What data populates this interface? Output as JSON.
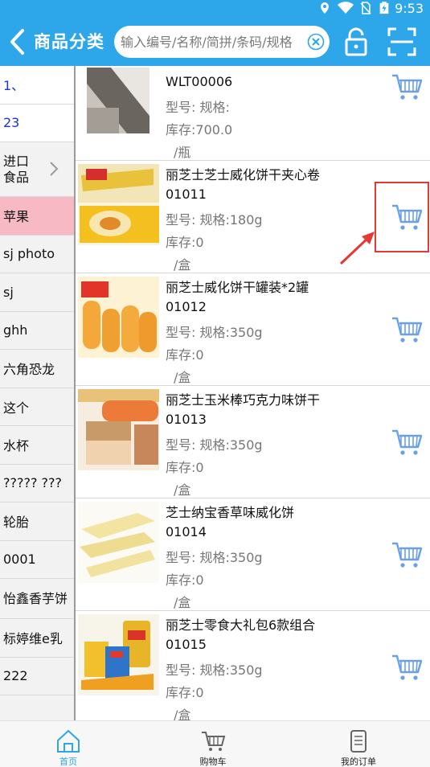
{
  "status_bar": {
    "time": "9:53"
  },
  "header": {
    "title": "商品分类",
    "search_placeholder": "输入编号/名称/简拼/条码/规格"
  },
  "sidebar": {
    "items": [
      {
        "label": "1、"
      },
      {
        "label": "23"
      },
      {
        "label": "进口\n食品"
      },
      {
        "label": "苹果"
      },
      {
        "label": "sj photo"
      },
      {
        "label": "sj"
      },
      {
        "label": "ghh"
      },
      {
        "label": "六角恐龙"
      },
      {
        "label": "这个"
      },
      {
        "label": "水杯"
      },
      {
        "label": "????? ???"
      },
      {
        "label": "轮胎"
      },
      {
        "label": "0001"
      },
      {
        "label": "怡鑫香芋饼"
      },
      {
        "label": "标婷维e乳"
      },
      {
        "label": "222"
      }
    ]
  },
  "products": [
    {
      "name": "",
      "code": "WLT00006",
      "spec": "型号:   规格:",
      "stock": "库存:700.0",
      "unit": "/瓶"
    },
    {
      "name": "丽芝士芝士威化饼干夹心卷",
      "code": "01011",
      "spec": "型号:   规格:180g",
      "stock": "库存:0",
      "unit": "/盒"
    },
    {
      "name": "丽芝士威化饼干罐装*2罐",
      "code": "01012",
      "spec": "型号:   规格:350g",
      "stock": "库存:0",
      "unit": "/盒"
    },
    {
      "name": "丽芝士玉米棒巧克力味饼干",
      "code": "01013",
      "spec": "型号:   规格:350g",
      "stock": "库存:0",
      "unit": "/盒"
    },
    {
      "name": "芝士纳宝香草味威化饼",
      "code": "01014",
      "spec": "型号:   规格:350g",
      "stock": "库存:0",
      "unit": "/盒"
    },
    {
      "name": "丽芝士零食大礼包6款组合",
      "code": "01015",
      "spec": "型号:   规格:350g",
      "stock": "库存:0",
      "unit": "/盒"
    }
  ],
  "bottom_nav": {
    "home": "首页",
    "cart": "购物车",
    "orders": "我的订单"
  },
  "colors": {
    "accent": "#2ea6ea",
    "active_category": "#f7b9c4",
    "highlight": "#e53935"
  }
}
